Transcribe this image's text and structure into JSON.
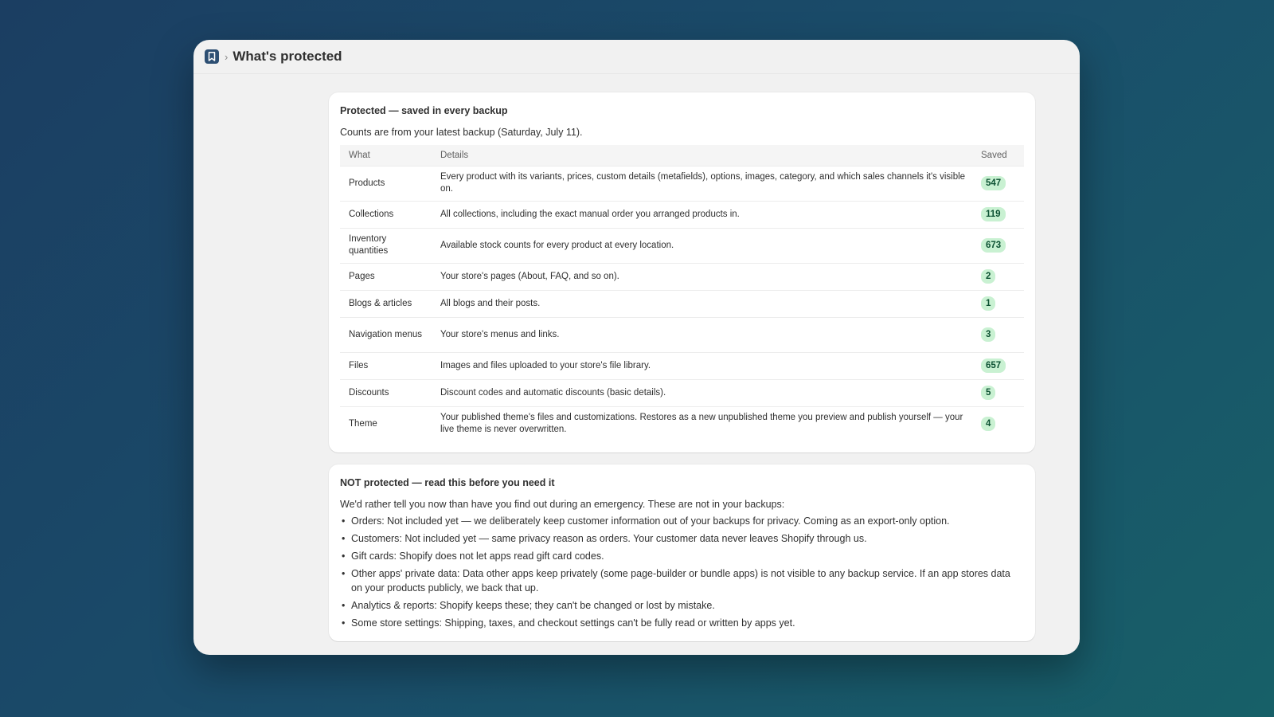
{
  "header": {
    "title": "What's protected",
    "breadcrumb_sep": "›"
  },
  "protected": {
    "heading": "Protected — saved in every backup",
    "subtitle": "Counts are from your latest backup (Saturday, July 11).",
    "columns": {
      "what": "What",
      "details": "Details",
      "saved": "Saved"
    },
    "rows": [
      {
        "what": "Products",
        "details": "Every product with its variants, prices, custom details (metafields), options, images, category, and which sales channels it's visible on.",
        "saved": "547"
      },
      {
        "what": "Collections",
        "details": "All collections, including the exact manual order you arranged products in.",
        "saved": "119"
      },
      {
        "what": "Inventory quantities",
        "details": "Available stock counts for every product at every location.",
        "saved": "673"
      },
      {
        "what": "Pages",
        "details": "Your store's pages (About, FAQ, and so on).",
        "saved": "2"
      },
      {
        "what": "Blogs & articles",
        "details": "All blogs and their posts.",
        "saved": "1"
      },
      {
        "what": "Navigation menus",
        "details": "Your store's menus and links.",
        "saved": "3"
      },
      {
        "what": "Files",
        "details": "Images and files uploaded to your store's file library.",
        "saved": "657"
      },
      {
        "what": "Discounts",
        "details": "Discount codes and automatic discounts (basic details).",
        "saved": "5"
      },
      {
        "what": "Theme",
        "details": "Your published theme's files and customizations. Restores as a new unpublished theme you preview and publish yourself — your live theme is never overwritten.",
        "saved": "4"
      }
    ]
  },
  "not_protected": {
    "heading": "NOT protected — read this before you need it",
    "subtitle": "We'd rather tell you now than have you find out during an emergency. These are not in your backups:",
    "items": [
      "Orders: Not included yet — we deliberately keep customer information out of your backups for privacy. Coming as an export-only option.",
      "Customers: Not included yet — same privacy reason as orders. Your customer data never leaves Shopify through us.",
      "Gift cards: Shopify does not let apps read gift card codes.",
      "Other apps' private data: Data other apps keep privately (some page-builder or bundle apps) is not visible to any backup service. If an app stores data on your products publicly, we back that up.",
      "Analytics & reports: Shopify keeps these; they can't be changed or lost by mistake.",
      "Some store settings: Shipping, taxes, and checkout settings can't be fully read or written by apps yet."
    ]
  },
  "colors": {
    "badge_bg": "#c9f1d2",
    "badge_text": "#0c5132",
    "app_icon": "#2d4f73"
  },
  "icons": {
    "app": "bookmark-icon",
    "breadcrumb": "chevron-right-icon"
  }
}
